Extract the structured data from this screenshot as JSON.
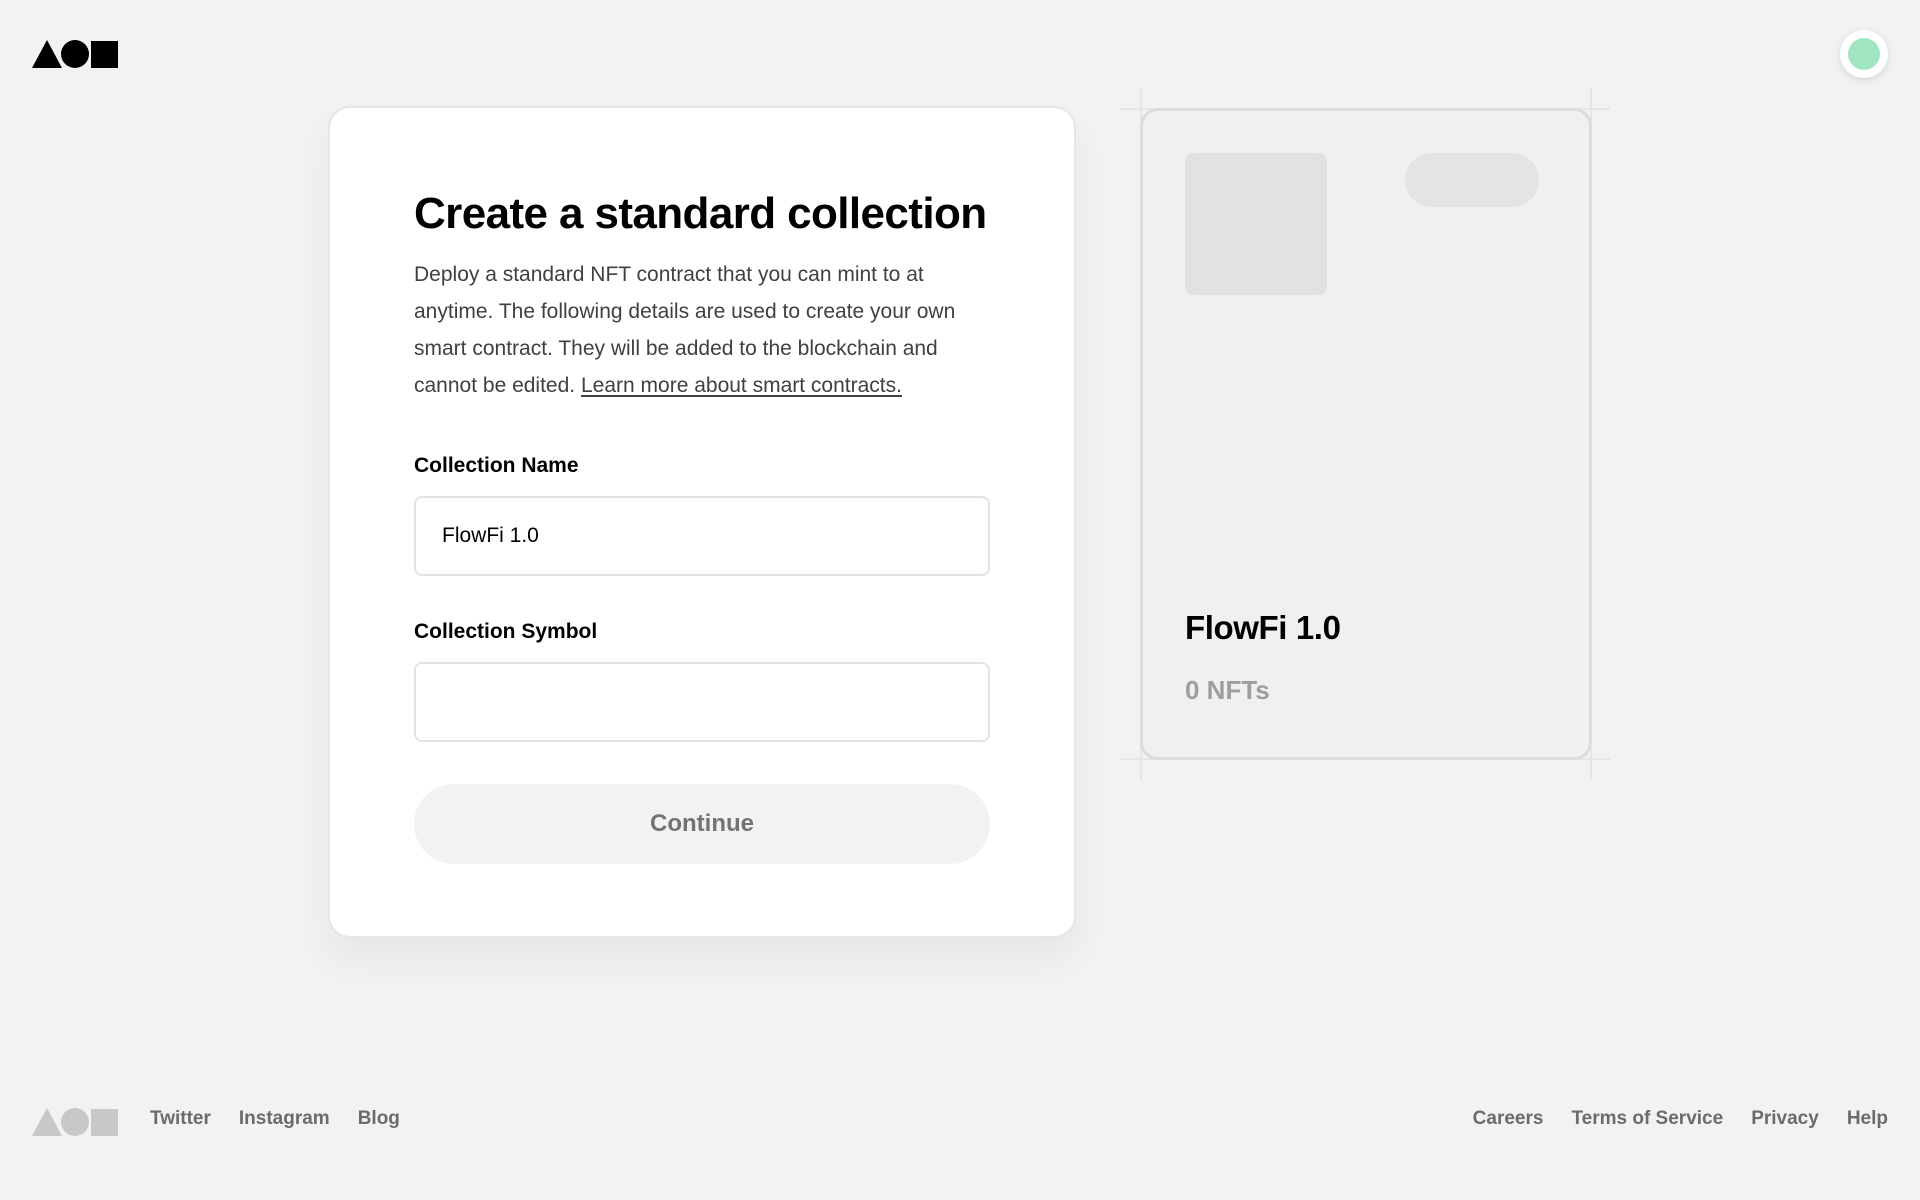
{
  "header": {
    "logo_icon": "triangle-circle-square-logo",
    "avatar_color": "#a2e5c1"
  },
  "form": {
    "title": "Create a standard collection",
    "description": "Deploy a standard NFT contract that you can mint to at anytime. The following details are used to create your own smart contract. They will be added to the blockchain and cannot be edited.",
    "learn_more_link": "Learn more about smart contracts.",
    "collection_name_label": "Collection Name",
    "collection_name_value": "FlowFi 1.0",
    "collection_symbol_label": "Collection Symbol",
    "collection_symbol_value": "",
    "continue_label": "Continue"
  },
  "preview": {
    "name": "FlowFi 1.0",
    "count": "0 NFTs"
  },
  "footer": {
    "logo_icon": "triangle-circle-square-logo",
    "left_links": [
      "Twitter",
      "Instagram",
      "Blog"
    ],
    "right_links": [
      "Careers",
      "Terms of Service",
      "Privacy",
      "Help"
    ]
  },
  "colors": {
    "background": "#f2f2f2",
    "card": "#ffffff",
    "button_disabled_bg": "#f2f2f2",
    "button_disabled_text": "#737373",
    "muted_text": "#9e9e9e"
  }
}
